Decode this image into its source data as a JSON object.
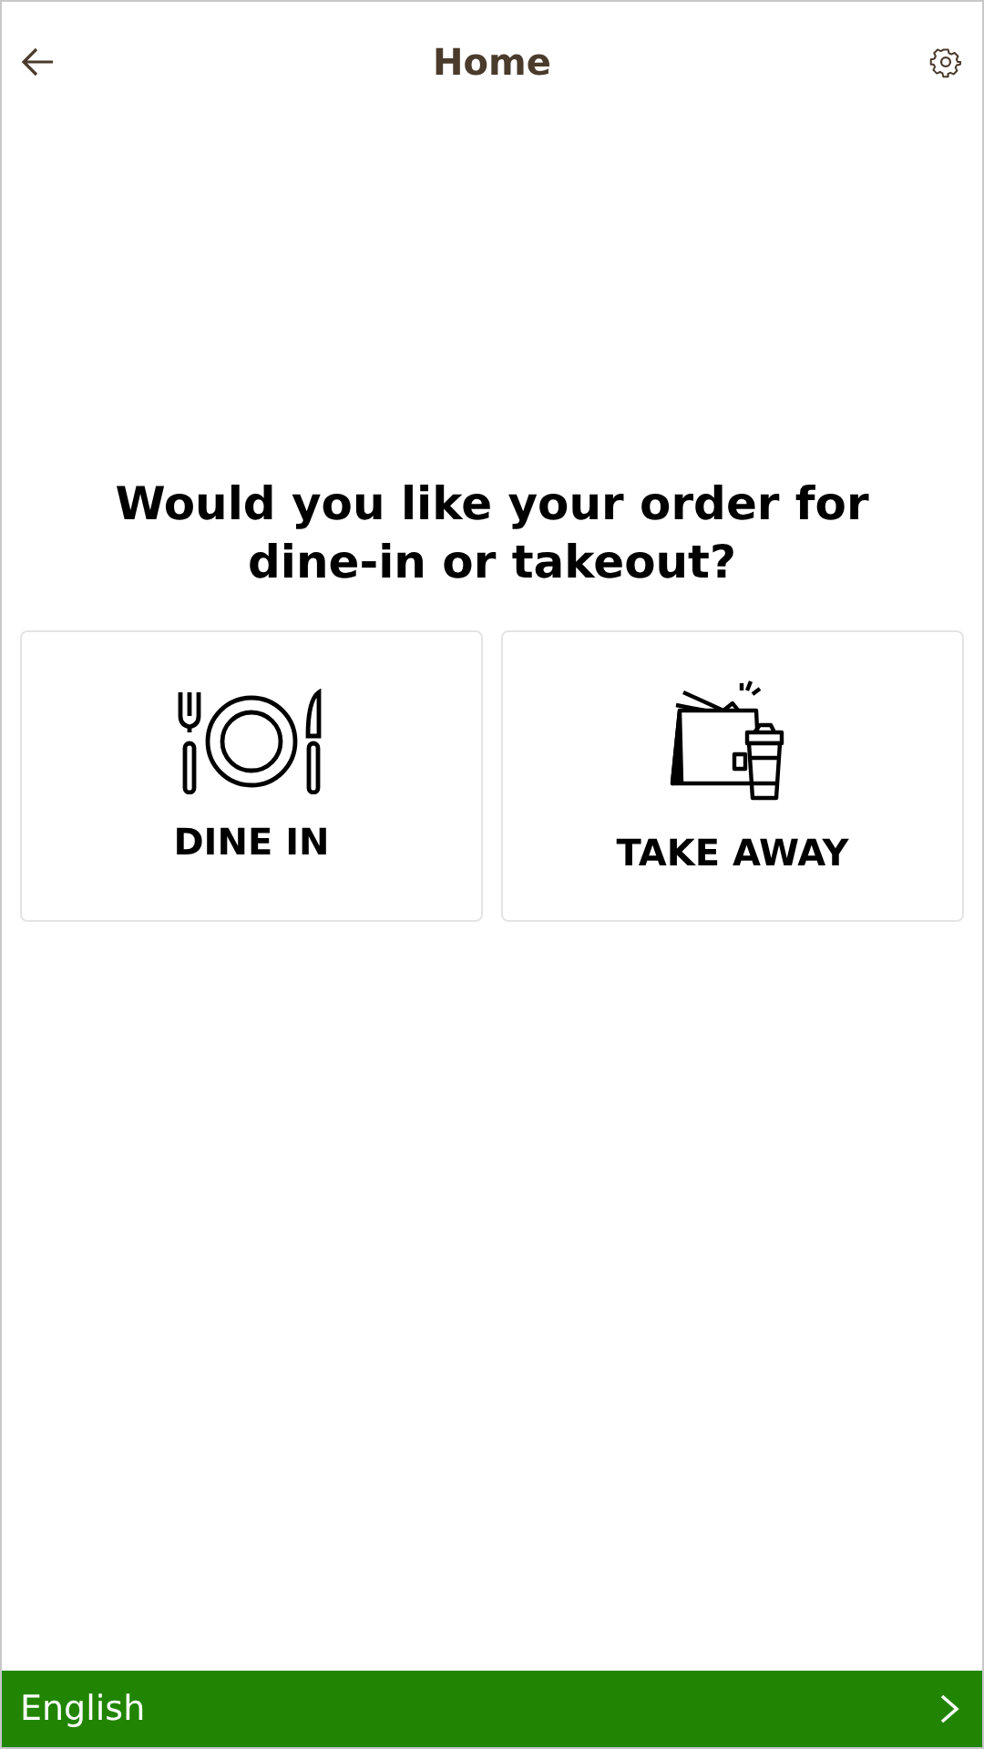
{
  "header": {
    "title": "Home"
  },
  "question": "Would you like your order for dine-in or takeout?",
  "options": [
    {
      "kind": "dine-in",
      "label": "DINE IN"
    },
    {
      "kind": "takeaway",
      "label": "TAKE AWAY"
    }
  ],
  "footer": {
    "language": "English"
  }
}
